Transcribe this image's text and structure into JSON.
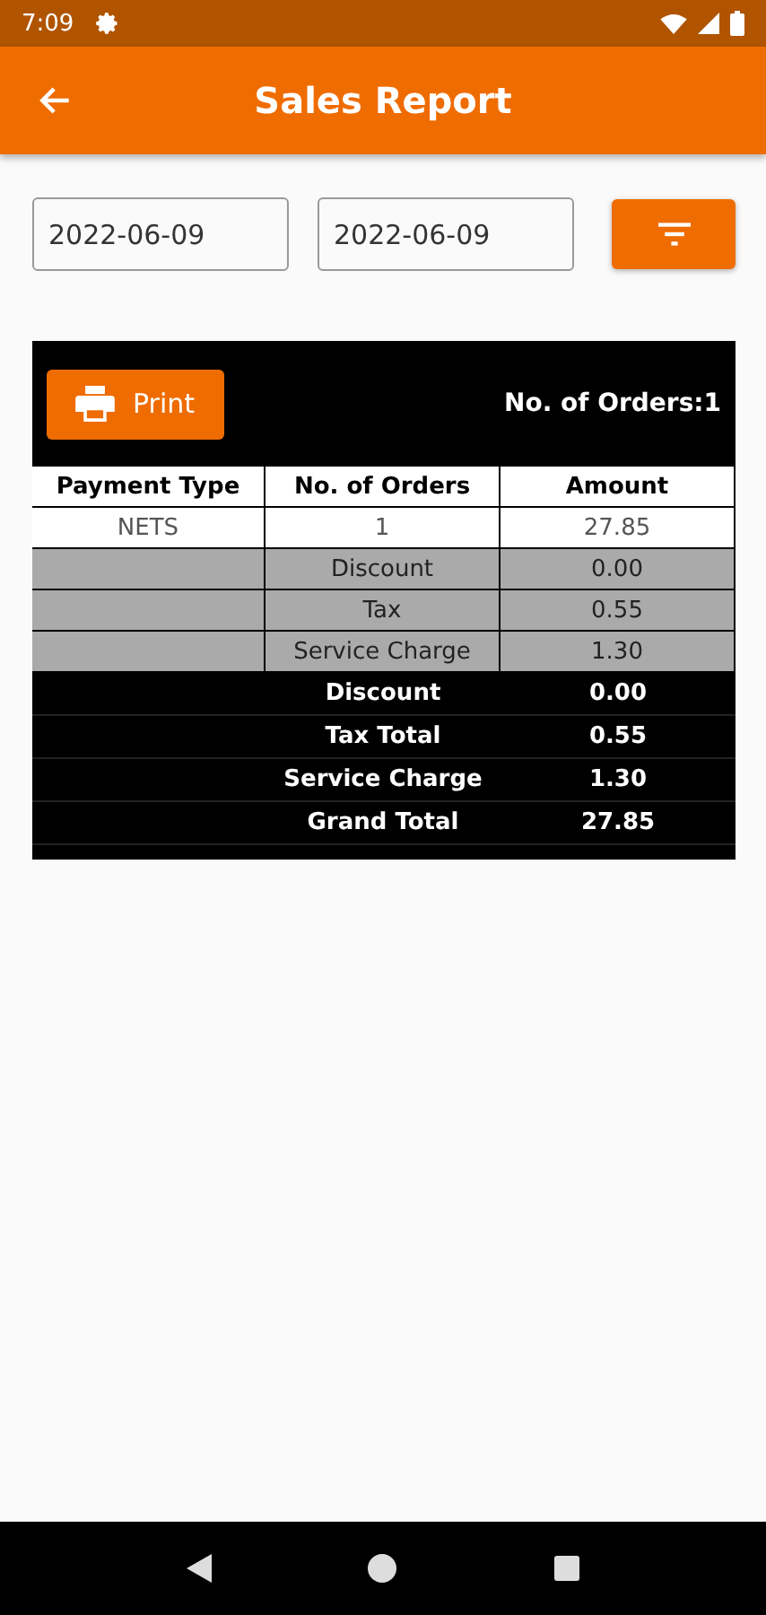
{
  "status_bar": {
    "time": "7:09"
  },
  "app_bar": {
    "title": "Sales Report"
  },
  "filters": {
    "from_date": "2022-06-09",
    "to_date": "2022-06-09"
  },
  "report": {
    "print_label": "Print",
    "orders_count": "No. of Orders:1",
    "columns": [
      "Payment Type",
      "No. of Orders",
      "Amount"
    ],
    "rows": [
      {
        "kind": "data",
        "cells": [
          "NETS",
          "1",
          "27.85"
        ]
      },
      {
        "kind": "sub",
        "cells": [
          "",
          "Discount",
          "0.00"
        ]
      },
      {
        "kind": "sub",
        "cells": [
          "",
          "Tax",
          "0.55"
        ]
      },
      {
        "kind": "sub",
        "cells": [
          "",
          "Service Charge",
          "1.30"
        ]
      },
      {
        "kind": "total",
        "cells": [
          "",
          "Discount",
          "0.00"
        ]
      },
      {
        "kind": "total",
        "cells": [
          "",
          "Tax Total",
          "0.55"
        ]
      },
      {
        "kind": "total",
        "cells": [
          "",
          "Service Charge",
          "1.30"
        ]
      },
      {
        "kind": "total",
        "cells": [
          "",
          "Grand Total",
          "27.85"
        ]
      }
    ]
  }
}
